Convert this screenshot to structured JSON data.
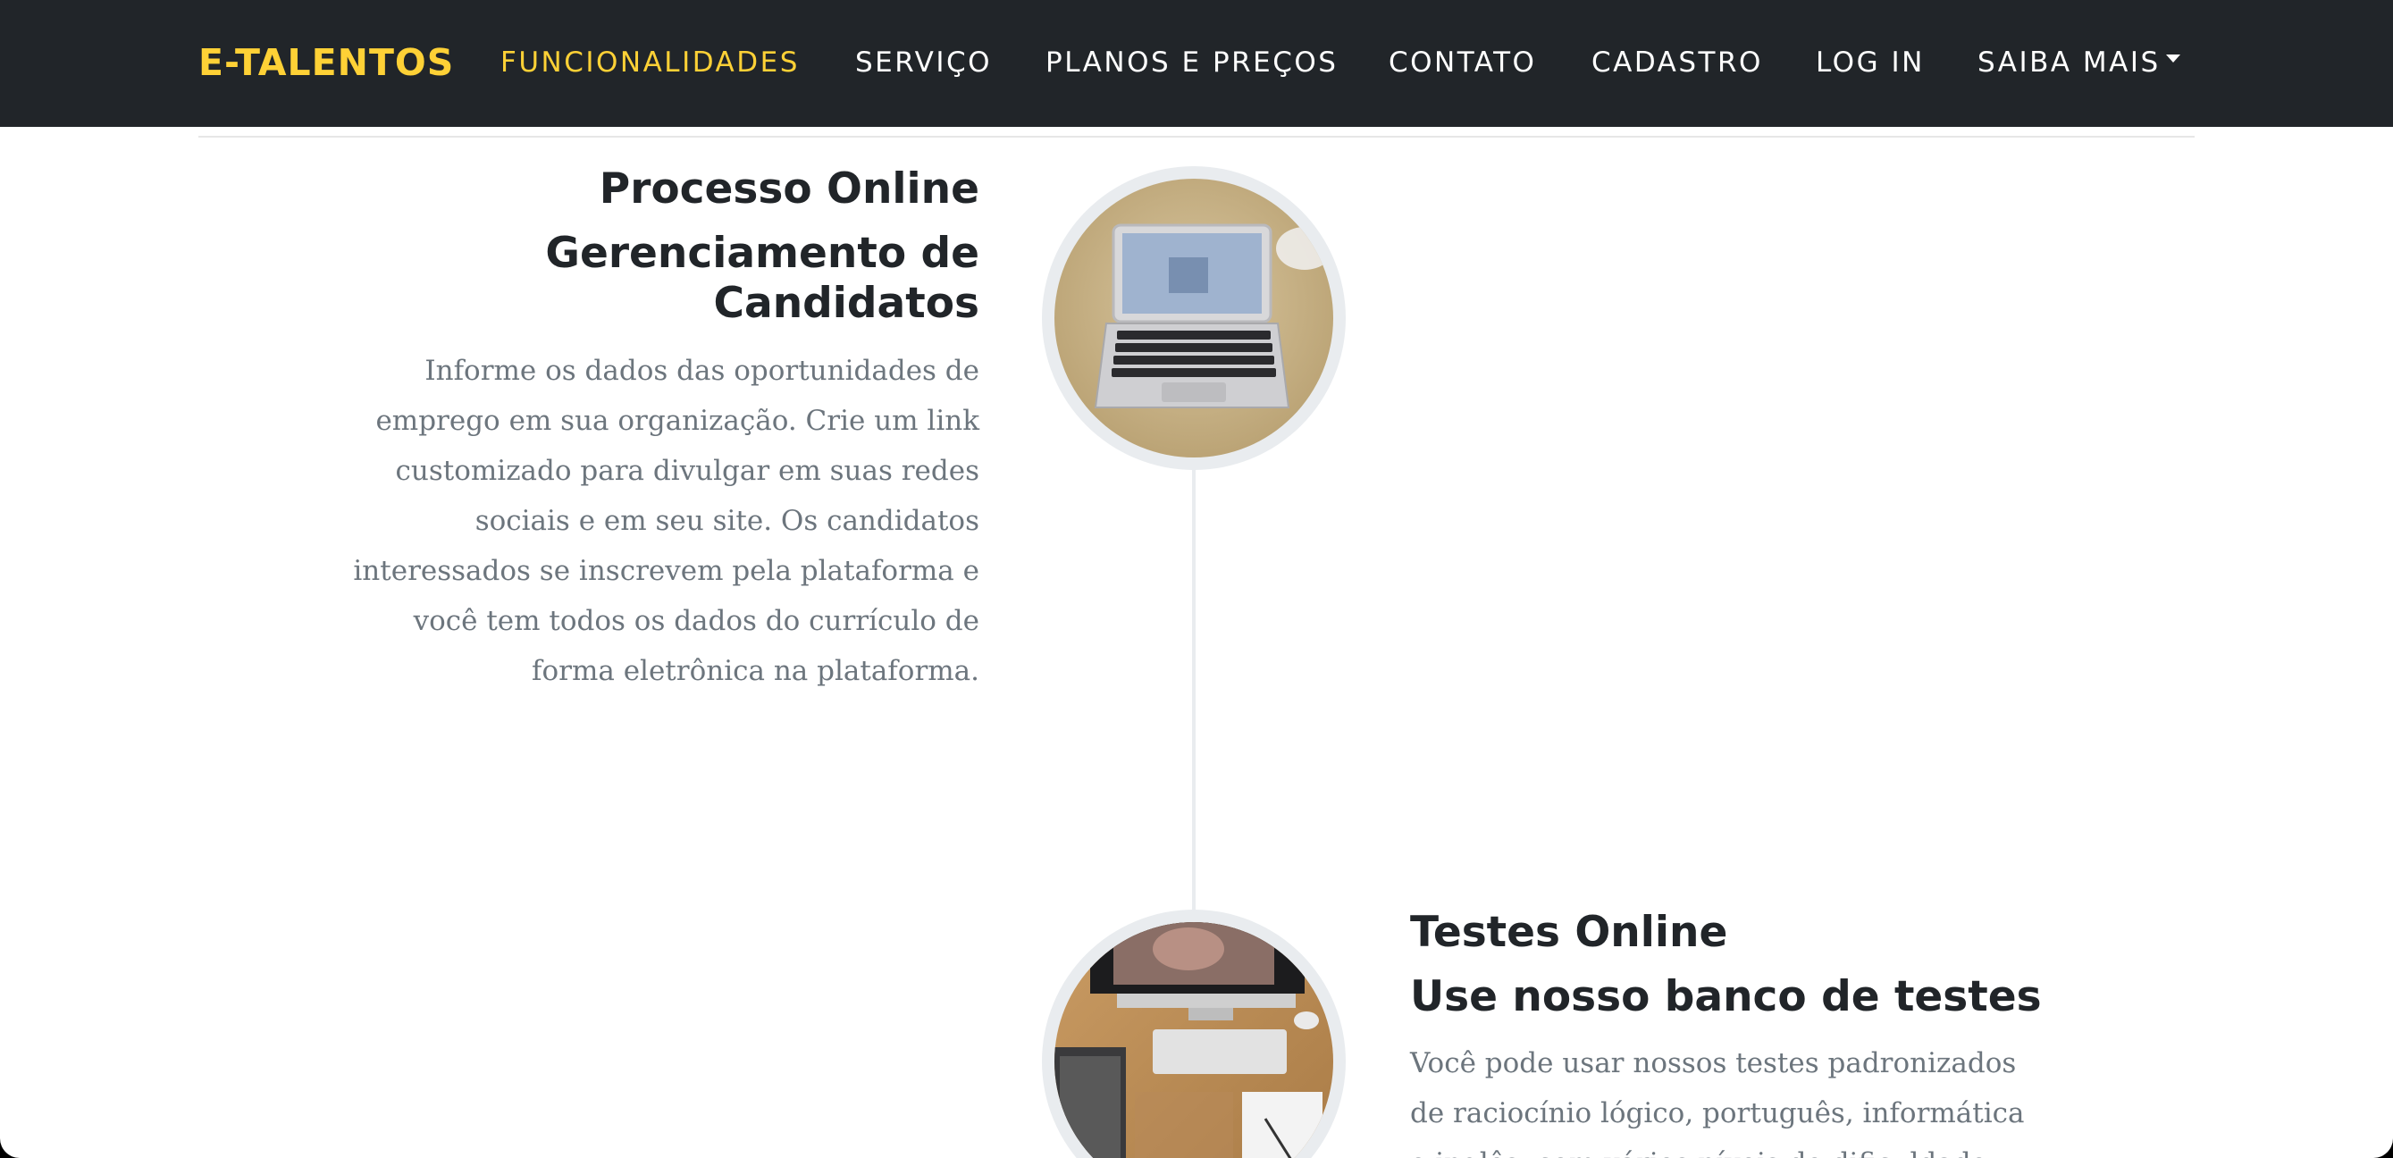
{
  "navbar": {
    "brand": "E-TALENTOS",
    "links": [
      {
        "label": "FUNCIONALIDADES",
        "active": true
      },
      {
        "label": "SERVIÇO"
      },
      {
        "label": "PLANOS E PREÇOS"
      },
      {
        "label": "CONTATO"
      },
      {
        "label": "CADASTRO"
      },
      {
        "label": "LOG IN"
      },
      {
        "label": "SAIBA MAIS",
        "dropdown": true
      }
    ]
  },
  "timeline": [
    {
      "title": "Processo Online",
      "subtitle_line1": "Gerenciamento de",
      "subtitle_line2": "Candidatos",
      "body_lines": [
        "Informe os dados das oportunidades de",
        "emprego em sua organização. Crie um link",
        "customizado para divulgar em suas redes",
        "sociais e em seu site. Os candidatos",
        "interessados se inscrevem pela plataforma e",
        "você tem todos os dados do currículo de",
        "forma eletrônica na plataforma."
      ],
      "image_icon": "laptop-photo"
    },
    {
      "title": "Testes Online",
      "subtitle": "Use nosso banco de testes",
      "body_lines": [
        "Você pode usar nossos testes padronizados",
        "de raciocínio lógico, português, informática",
        "e inglês, com vários níveis de dificuldade"
      ],
      "image_icon": "desk-photo"
    }
  ],
  "colors": {
    "navbar_bg": "#212529",
    "accent": "#fed136",
    "heading": "#212529",
    "muted_text": "#6c757d",
    "timeline_gray": "#e9ecef"
  }
}
